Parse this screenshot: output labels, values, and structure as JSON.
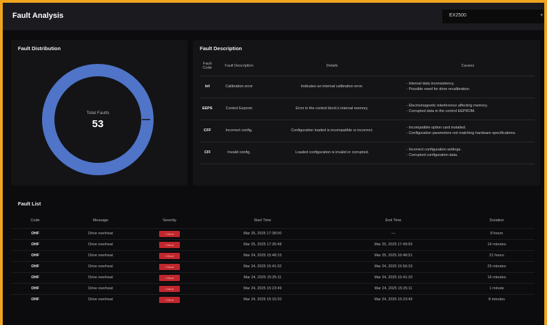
{
  "header": {
    "title": "Fault Analysis",
    "device": "EX2500"
  },
  "distribution": {
    "title": "Fault Distribution",
    "center_label": "Total Faults",
    "total": "53",
    "color": "#4f74c8"
  },
  "description": {
    "title": "Fault Description",
    "columns": [
      "Fault Code",
      "Fault Description",
      "Details",
      "Causes"
    ],
    "rows": [
      {
        "code": "Inf",
        "desc": "Calibration error",
        "details": "Indicates an internal calibration error.",
        "causes": [
          "- Internal data inconsistency.",
          "- Possible need for drive recalibration."
        ]
      },
      {
        "code": "EEPS",
        "desc": "Control Eeprom",
        "details": "Error in the control block's internal memory.",
        "causes": [
          "- Electromagnetic interference affecting memory.",
          "- Corrupted data in the control EEPROM."
        ]
      },
      {
        "code": "CFF",
        "desc": "Incorrect config.",
        "details": "Configuration loaded is incompatible or incorrect.",
        "causes": [
          "- Incompatible option card installed.",
          "- Configuration parameters not matching hardware specifications."
        ]
      },
      {
        "code": "CFI",
        "desc": "Invalid config.",
        "details": "Loaded configuration is invalid or corrupted.",
        "causes": [
          "- Incorrect configuration settings.",
          "- Corrupted configuration data."
        ]
      }
    ]
  },
  "fault_list": {
    "title": "Fault List",
    "columns": [
      "Code",
      "Message",
      "Severity",
      "Start Time",
      "End Time",
      "Duration"
    ],
    "severity_color": "#c0272d",
    "rows": [
      {
        "code": "OHF",
        "message": "Drive overheat",
        "severity": "Critical",
        "start": "Mar 25, 2025 17:38:00",
        "end": "—",
        "duration": "8 hours"
      },
      {
        "code": "OHF",
        "message": "Drive overheat",
        "severity": "Critical",
        "start": "Mar 25, 2025 17:35:48",
        "end": "Mar 25, 2025 17:49:55",
        "duration": "14 minutes"
      },
      {
        "code": "OHF",
        "message": "Drive overheat",
        "severity": "Critical",
        "start": "Mar 24, 2025 15:48:15",
        "end": "Mar 25, 2025 16:48:51",
        "duration": "21 hours"
      },
      {
        "code": "OHF",
        "message": "Drive overheat",
        "severity": "Critical",
        "start": "Mar 24, 2025 15:41:32",
        "end": "Mar 24, 2025 15:56:33",
        "duration": "25 minutes"
      },
      {
        "code": "OHF",
        "message": "Drive overheat",
        "severity": "Critical",
        "start": "Mar 24, 2025 15:25:11",
        "end": "Mar 24, 2025 15:41:20",
        "duration": "16 minutes"
      },
      {
        "code": "OHF",
        "message": "Drive overheat",
        "severity": "Critical",
        "start": "Mar 24, 2025 15:23:49",
        "end": "Mar 24, 2025 15:25:11",
        "duration": "1 minute"
      },
      {
        "code": "OHF",
        "message": "Drive overheat",
        "severity": "Critical",
        "start": "Mar 24, 2025 15:15:20",
        "end": "Mar 24, 2025 15:23:49",
        "duration": "8 minutes"
      }
    ]
  }
}
